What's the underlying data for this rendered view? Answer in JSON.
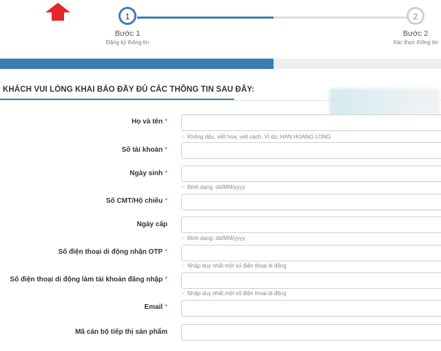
{
  "stepper": {
    "steps": [
      {
        "number": "1",
        "title": "Bước 1",
        "subtitle": "Đăng ký thông tin"
      },
      {
        "number": "2",
        "title": "Bước 2",
        "subtitle": "Xác thực thông tin"
      }
    ]
  },
  "progress": {
    "fraction": 0.62
  },
  "form": {
    "heading": "KHÁCH VUI LÒNG KHAI BÁO ĐẦY ĐỦ CÁC THÔNG TIN SAU ĐÂY:",
    "required_mark": "*",
    "fields": [
      {
        "label": "Họ và tên",
        "required": true,
        "hint": "Không dấu, viết hoa, viết cách. Ví dụ: HAN HOANG LONG"
      },
      {
        "label": "Số tài khoản",
        "required": true,
        "hint": ""
      },
      {
        "label": "Ngày sinh",
        "required": true,
        "hint": "Định dạng: dd/MM/yyyy"
      },
      {
        "label": "Số CMT/Hộ chiếu",
        "required": true,
        "hint": ""
      },
      {
        "label": "Ngày cấp",
        "required": false,
        "hint": "Định dạng: dd/MM/yyyy"
      },
      {
        "label": "Số điện thoại di động nhận OTP",
        "required": true,
        "hint": "Nhập duy nhất một số điện thoại di động"
      },
      {
        "label": "Số điện thoại di động làm tài khoản đăng nhập",
        "required": true,
        "hint": "Nhập duy nhất một số điện thoại di động"
      },
      {
        "label": "Email",
        "required": true,
        "hint": ""
      },
      {
        "label": "Mã cán bộ tiếp thị sản phẩm",
        "required": false,
        "hint": ""
      }
    ]
  },
  "colors": {
    "accent": "#3d7ab8",
    "required": "#e03c3c",
    "logo": "#e3262a"
  }
}
